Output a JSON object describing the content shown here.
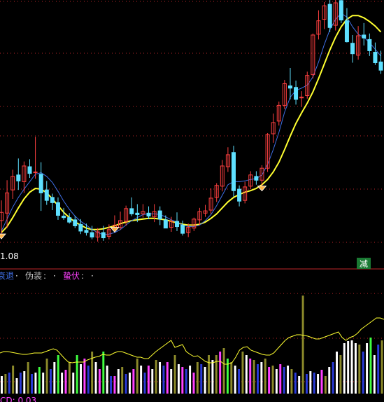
{
  "chart_data": [
    {
      "type": "candlestick",
      "panel": "price",
      "price_label": "1.08",
      "badge": {
        "text": "减",
        "color": "#2db84d"
      },
      "colors": {
        "up": "#ff4040",
        "down": "#5ee0ff",
        "ma_short": "#3f6fe6",
        "ma_long": "#ffff30",
        "grid": "#c0262a"
      },
      "ohlc": [
        [
          118.4,
          121.1,
          116.0,
          119.5
        ],
        [
          119.4,
          123.8,
          117.4,
          122.1
        ],
        [
          122.5,
          125.2,
          121.3,
          124.3
        ],
        [
          124.5,
          126.7,
          122.5,
          123.7
        ],
        [
          123.6,
          126.3,
          122.1,
          125.7
        ],
        [
          125.6,
          126.6,
          124.1,
          124.7
        ],
        [
          124.8,
          129.6,
          124.0,
          124.9
        ],
        [
          124.6,
          126.2,
          119.7,
          122.1
        ],
        [
          122.5,
          123.7,
          120.5,
          121.1
        ],
        [
          121.5,
          122.0,
          119.8,
          120.8
        ],
        [
          120.8,
          121.5,
          118.5,
          119.1
        ],
        [
          119.0,
          120.1,
          118.5,
          118.8
        ],
        [
          118.8,
          119.4,
          118.0,
          118.2
        ],
        [
          118.5,
          119.0,
          117.4,
          117.7
        ],
        [
          117.9,
          118.6,
          116.6,
          117.0
        ],
        [
          117.1,
          118.0,
          116.4,
          116.8
        ],
        [
          116.8,
          117.7,
          115.9,
          116.2
        ],
        [
          116.2,
          117.4,
          115.6,
          116.9
        ],
        [
          116.8,
          117.7,
          115.7,
          116.1
        ],
        [
          116.3,
          117.9,
          115.9,
          117.2
        ],
        [
          117.4,
          119.1,
          116.9,
          117.8
        ],
        [
          117.5,
          119.6,
          117.2,
          118.4
        ],
        [
          118.3,
          120.4,
          117.7,
          120.0
        ],
        [
          120.0,
          121.5,
          119.0,
          119.3
        ],
        [
          119.4,
          120.6,
          118.2,
          119.2
        ],
        [
          119.3,
          120.6,
          118.8,
          119.6
        ],
        [
          119.4,
          120.3,
          118.6,
          119.0
        ],
        [
          118.9,
          120.6,
          118.2,
          119.6
        ],
        [
          119.7,
          120.3,
          117.8,
          118.6
        ],
        [
          118.5,
          119.1,
          117.5,
          117.4
        ],
        [
          117.5,
          118.9,
          116.9,
          118.3
        ],
        [
          118.3,
          119.5,
          117.0,
          117.6
        ],
        [
          117.8,
          118.4,
          116.4,
          116.7
        ],
        [
          116.8,
          118.0,
          116.2,
          117.5
        ],
        [
          117.4,
          118.8,
          117.0,
          118.6
        ],
        [
          118.5,
          120.1,
          117.8,
          119.6
        ],
        [
          119.4,
          120.5,
          118.9,
          119.7
        ],
        [
          119.8,
          122.7,
          119.3,
          121.4
        ],
        [
          121.5,
          123.4,
          120.9,
          123.1
        ],
        [
          123.0,
          126.5,
          122.3,
          125.7
        ],
        [
          125.6,
          128.2,
          124.9,
          127.2
        ],
        [
          127.5,
          128.4,
          121.6,
          122.4
        ],
        [
          122.6,
          123.1,
          120.3,
          121.0
        ],
        [
          121.1,
          123.6,
          120.7,
          122.9
        ],
        [
          123.0,
          125.0,
          122.6,
          124.5
        ],
        [
          124.3,
          125.0,
          123.2,
          123.8
        ],
        [
          123.8,
          125.8,
          122.6,
          125.4
        ],
        [
          125.4,
          130.1,
          124.9,
          129.9
        ],
        [
          130.0,
          132.7,
          128.8,
          131.5
        ],
        [
          131.7,
          134.3,
          131.1,
          133.8
        ],
        [
          133.8,
          137.2,
          133.3,
          136.7
        ],
        [
          136.4,
          138.8,
          134.6,
          136.1
        ],
        [
          136.2,
          137.1,
          133.9,
          134.6
        ],
        [
          134.8,
          135.7,
          133.6,
          134.9
        ],
        [
          135.1,
          138.3,
          134.7,
          137.8
        ],
        [
          137.9,
          143.4,
          137.4,
          143.2
        ],
        [
          143.3,
          146.5,
          142.6,
          145.1
        ],
        [
          145.3,
          147.6,
          144.0,
          147.1
        ],
        [
          147.3,
          148.2,
          143.6,
          144.2
        ],
        [
          144.5,
          148.1,
          143.8,
          147.5
        ],
        [
          147.8,
          148.7,
          144.8,
          145.2
        ],
        [
          145.1,
          146.8,
          142.2,
          142.3
        ],
        [
          142.1,
          143.2,
          139.5,
          140.7
        ],
        [
          140.5,
          144.4,
          139.9,
          143.1
        ],
        [
          143.2,
          144.8,
          141.8,
          142.8
        ],
        [
          142.6,
          143.4,
          140.4,
          141.1
        ],
        [
          140.9,
          142.2,
          139.2,
          139.5
        ],
        [
          139.6,
          141.1,
          138.0,
          138.5
        ]
      ],
      "ma_short": [
        117.0,
        118.6,
        120.2,
        121.5,
        122.6,
        123.6,
        124.6,
        124.8,
        124.3,
        123.5,
        122.3,
        121.0,
        119.9,
        119.0,
        118.3,
        117.8,
        117.2,
        116.8,
        116.5,
        116.6,
        116.8,
        117.2,
        117.8,
        118.4,
        118.8,
        119.2,
        119.3,
        119.3,
        119.2,
        118.9,
        118.5,
        118.2,
        117.8,
        117.6,
        117.6,
        117.8,
        118.4,
        119.2,
        120.4,
        121.8,
        123.2,
        123.6,
        123.6,
        123.7,
        123.9,
        124.0,
        124.5,
        125.9,
        127.9,
        130.2,
        132.9,
        134.9,
        135.8,
        136.1,
        136.5,
        137.6,
        139.6,
        141.9,
        143.9,
        145.3,
        146.1,
        145.6,
        144.3,
        143.3,
        142.9,
        142.2,
        141.3,
        140.4
      ],
      "ma_long": [
        116.8,
        117.6,
        118.8,
        120.1,
        121.3,
        122.2,
        122.7,
        122.6,
        122.1,
        121.3,
        120.4,
        119.5,
        118.8,
        118.2,
        117.8,
        117.4,
        117.2,
        117.2,
        117.3,
        117.5,
        117.7,
        118.0,
        118.2,
        118.4,
        118.5,
        118.6,
        118.7,
        118.7,
        118.6,
        118.5,
        118.3,
        118.1,
        117.9,
        117.8,
        117.8,
        117.9,
        118.2,
        118.7,
        119.3,
        120.1,
        120.9,
        121.5,
        121.9,
        122.2,
        122.4,
        122.7,
        123.2,
        123.9,
        124.9,
        126.2,
        127.9,
        129.7,
        131.4,
        132.8,
        134.1,
        135.6,
        137.4,
        139.3,
        141.2,
        142.9,
        144.3,
        145.3,
        145.8,
        145.8,
        145.5,
        145.0,
        144.4,
        143.6
      ],
      "diamond_markers": [
        0,
        20,
        46
      ],
      "y_range": [
        114.0,
        149.0
      ]
    },
    {
      "type": "bar",
      "panel": "indicator",
      "legend": [
        {
          "text": "衰退",
          "color": "#3f6fe6"
        },
        {
          "text": "·",
          "color": "#ffffff"
        },
        {
          "text": "伪装",
          "color": "#c8c8c8"
        },
        {
          "text": ":",
          "color": "#c8c8c8"
        },
        {
          "text": "·",
          "color": "#ffffff"
        },
        {
          "text": "蛰伏",
          "color": "#ff40ff"
        },
        {
          "text": ":",
          "color": "#c8c8c8"
        },
        {
          "text": "·",
          "color": "#ffffff"
        }
      ],
      "bottom_label": "CD: 0.03",
      "bottom_label_color": "#ff40ff",
      "colors": {
        "white": "#ffffff",
        "blue": "#2a3ad8",
        "magenta": "#ff40ff",
        "green": "#40ff40",
        "olive": "#8c8a2a"
      },
      "bars": [
        [
          "white",
          0.25
        ],
        [
          "olive",
          0.28
        ],
        [
          "blue",
          0.3
        ],
        [
          "olive",
          0.4
        ],
        [
          "white",
          0.22
        ],
        [
          "blue",
          0.3
        ],
        [
          "white",
          0.32
        ],
        [
          "olive",
          0.45
        ],
        [
          "blue",
          0.28
        ],
        [
          "white",
          0.3
        ],
        [
          "green",
          0.38
        ],
        [
          "white",
          0.3
        ],
        [
          "olive",
          0.5
        ],
        [
          "blue",
          0.35
        ],
        [
          "white",
          0.45
        ],
        [
          "green",
          0.55
        ],
        [
          "white",
          0.3
        ],
        [
          "magenta",
          0.34
        ],
        [
          "olive",
          0.45
        ],
        [
          "white",
          0.3
        ],
        [
          "green",
          0.55
        ],
        [
          "white",
          0.42
        ],
        [
          "magenta",
          0.5
        ],
        [
          "blue",
          0.4
        ],
        [
          "olive",
          0.6
        ],
        [
          "white",
          0.45
        ],
        [
          "magenta",
          0.35
        ],
        [
          "green",
          0.6
        ],
        [
          "white",
          0.4
        ],
        [
          "blue",
          0.25
        ],
        [
          "magenta",
          0.25
        ],
        [
          "white",
          0.35
        ],
        [
          "olive",
          0.38
        ],
        [
          "blue",
          0.28
        ],
        [
          "white",
          0.3
        ],
        [
          "magenta",
          0.35
        ],
        [
          "olive",
          0.5
        ],
        [
          "white",
          0.4
        ],
        [
          "blue",
          0.3
        ],
        [
          "magenta",
          0.4
        ],
        [
          "white",
          0.35
        ],
        [
          "olive",
          0.48
        ],
        [
          "white",
          0.45
        ],
        [
          "blue",
          0.4
        ],
        [
          "magenta",
          0.45
        ],
        [
          "white",
          0.35
        ],
        [
          "olive",
          0.55
        ],
        [
          "white",
          0.42
        ],
        [
          "magenta",
          0.38
        ],
        [
          "blue",
          0.35
        ],
        [
          "white",
          0.4
        ],
        [
          "magenta",
          0.3
        ],
        [
          "olive",
          0.45
        ],
        [
          "blue",
          0.42
        ],
        [
          "white",
          0.38
        ],
        [
          "olive",
          0.55
        ],
        [
          "white",
          0.48
        ],
        [
          "olive",
          0.55
        ],
        [
          "magenta",
          0.6
        ],
        [
          "olive",
          0.65
        ],
        [
          "green",
          0.5
        ],
        [
          "olive",
          0.45
        ],
        [
          "white",
          0.4
        ],
        [
          "blue",
          0.35
        ],
        [
          "olive",
          0.6
        ],
        [
          "white",
          0.55
        ],
        [
          "magenta",
          0.5
        ],
        [
          "olive",
          0.48
        ],
        [
          "blue",
          0.42
        ],
        [
          "white",
          0.45
        ],
        [
          "olive",
          0.5
        ],
        [
          "magenta",
          0.38
        ],
        [
          "olive",
          0.4
        ],
        [
          "white",
          0.35
        ],
        [
          "magenta",
          0.42
        ],
        [
          "blue",
          0.38
        ],
        [
          "white",
          0.4
        ],
        [
          "olive",
          0.35
        ],
        [
          "blue",
          0.3
        ],
        [
          "white",
          0.25
        ],
        [
          "olive",
          1.4
        ],
        [
          "blue",
          0.28
        ],
        [
          "white",
          0.32
        ],
        [
          "blue",
          0.3
        ],
        [
          "white",
          0.28
        ],
        [
          "magenta",
          0.34
        ],
        [
          "olive",
          0.25
        ],
        [
          "white",
          0.38
        ],
        [
          "blue",
          0.45
        ],
        [
          "white",
          0.6
        ],
        [
          "olive",
          0.55
        ],
        [
          "white",
          0.72
        ],
        [
          "white",
          0.75
        ],
        [
          "white",
          0.76
        ],
        [
          "white",
          0.72
        ],
        [
          "olive",
          0.7
        ],
        [
          "blue",
          0.6
        ],
        [
          "white",
          0.72
        ],
        [
          "green",
          0.8
        ],
        [
          "white",
          0.55
        ],
        [
          "blue",
          0.7
        ],
        [
          "olive",
          0.76
        ]
      ],
      "signal_line": [
        0.58,
        0.6,
        0.6,
        0.59,
        0.58,
        0.57,
        0.56,
        0.56,
        0.57,
        0.58,
        0.58,
        0.58,
        0.6,
        0.62,
        0.64,
        0.62,
        0.56,
        0.5,
        0.45,
        0.44,
        0.45,
        0.45,
        0.45,
        0.48,
        0.5,
        0.52,
        0.53,
        0.56,
        0.55,
        0.55,
        0.58,
        0.6,
        0.6,
        0.58,
        0.56,
        0.54,
        0.52,
        0.52,
        0.5,
        0.5,
        0.55,
        0.6,
        0.64,
        0.68,
        0.72,
        0.76,
        0.66,
        0.68,
        0.7,
        0.6,
        0.56,
        0.53,
        0.54,
        0.5,
        0.46,
        0.44,
        0.44,
        0.46,
        0.46,
        0.42,
        0.42,
        0.44,
        0.52,
        0.62,
        0.66,
        0.67,
        0.62,
        0.6,
        0.58,
        0.56,
        0.55,
        0.55,
        0.58,
        0.64,
        0.7,
        0.76,
        0.8,
        0.82,
        0.84,
        0.84,
        0.83,
        0.82,
        0.8,
        0.78,
        0.78,
        0.8,
        0.82,
        0.84,
        0.86,
        0.88,
        0.8,
        0.76,
        0.8,
        0.82,
        0.86,
        0.92,
        0.96,
        1.0,
        1.04,
        1.08,
        1.08,
        1.06
      ]
    }
  ]
}
